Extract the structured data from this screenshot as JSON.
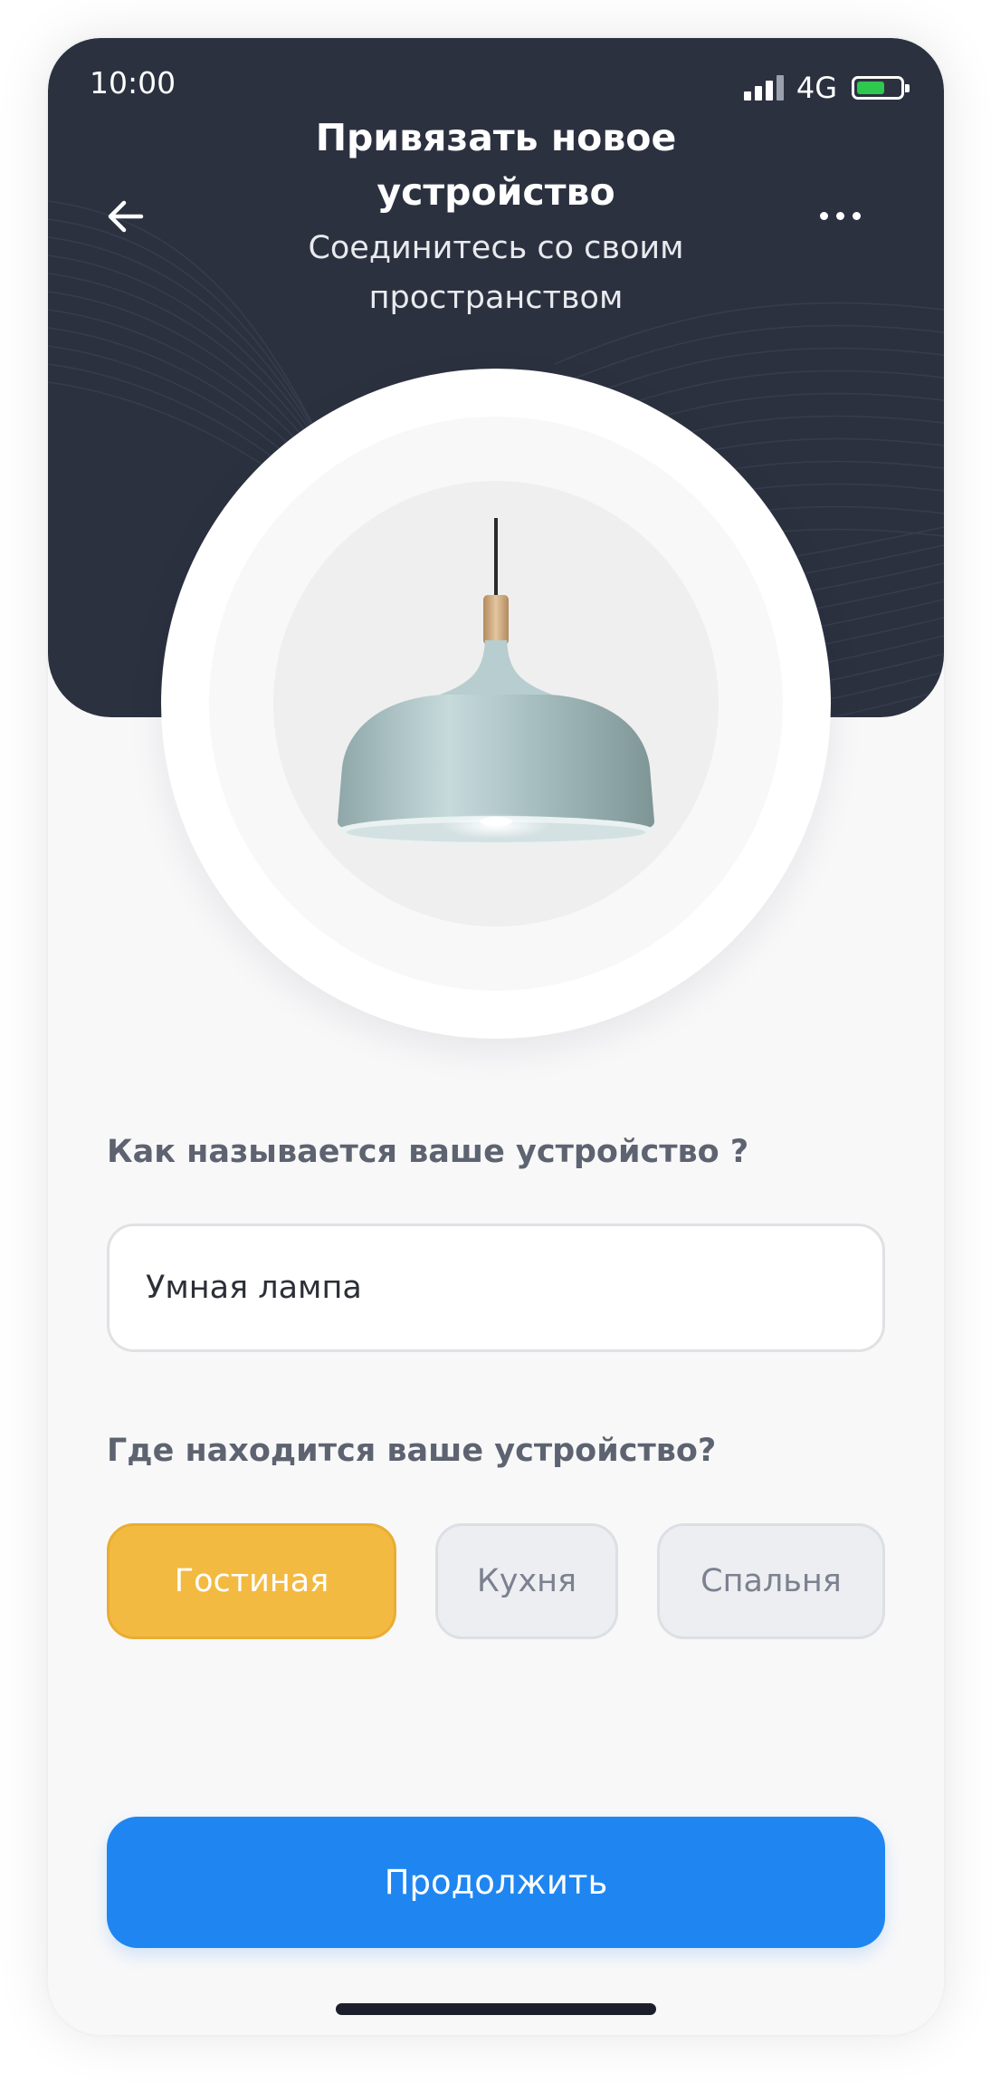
{
  "status_bar": {
    "time": "10:00",
    "network": "4G",
    "battery_color": "#2dc84d"
  },
  "header": {
    "title": "Привязать новое устройство",
    "subtitle": "Соединитесь со своим пространством",
    "back_icon": "arrow-left-icon",
    "more_icon": "more-horizontal-icon",
    "background_color": "#2c3140"
  },
  "device_image": {
    "icon": "pendant-lamp-image"
  },
  "form": {
    "name_question": "Как называется ваше устройство ?",
    "name_value": "Умная лампа",
    "location_question": "Где находится ваше устройство?",
    "locations": [
      {
        "label": "Гостиная",
        "selected": true
      },
      {
        "label": "Кухня",
        "selected": false
      },
      {
        "label": "Спальня",
        "selected": false
      }
    ],
    "selected_color": "#f3ba42"
  },
  "actions": {
    "continue_label": "Продолжить",
    "continue_color": "#1f86f1"
  }
}
